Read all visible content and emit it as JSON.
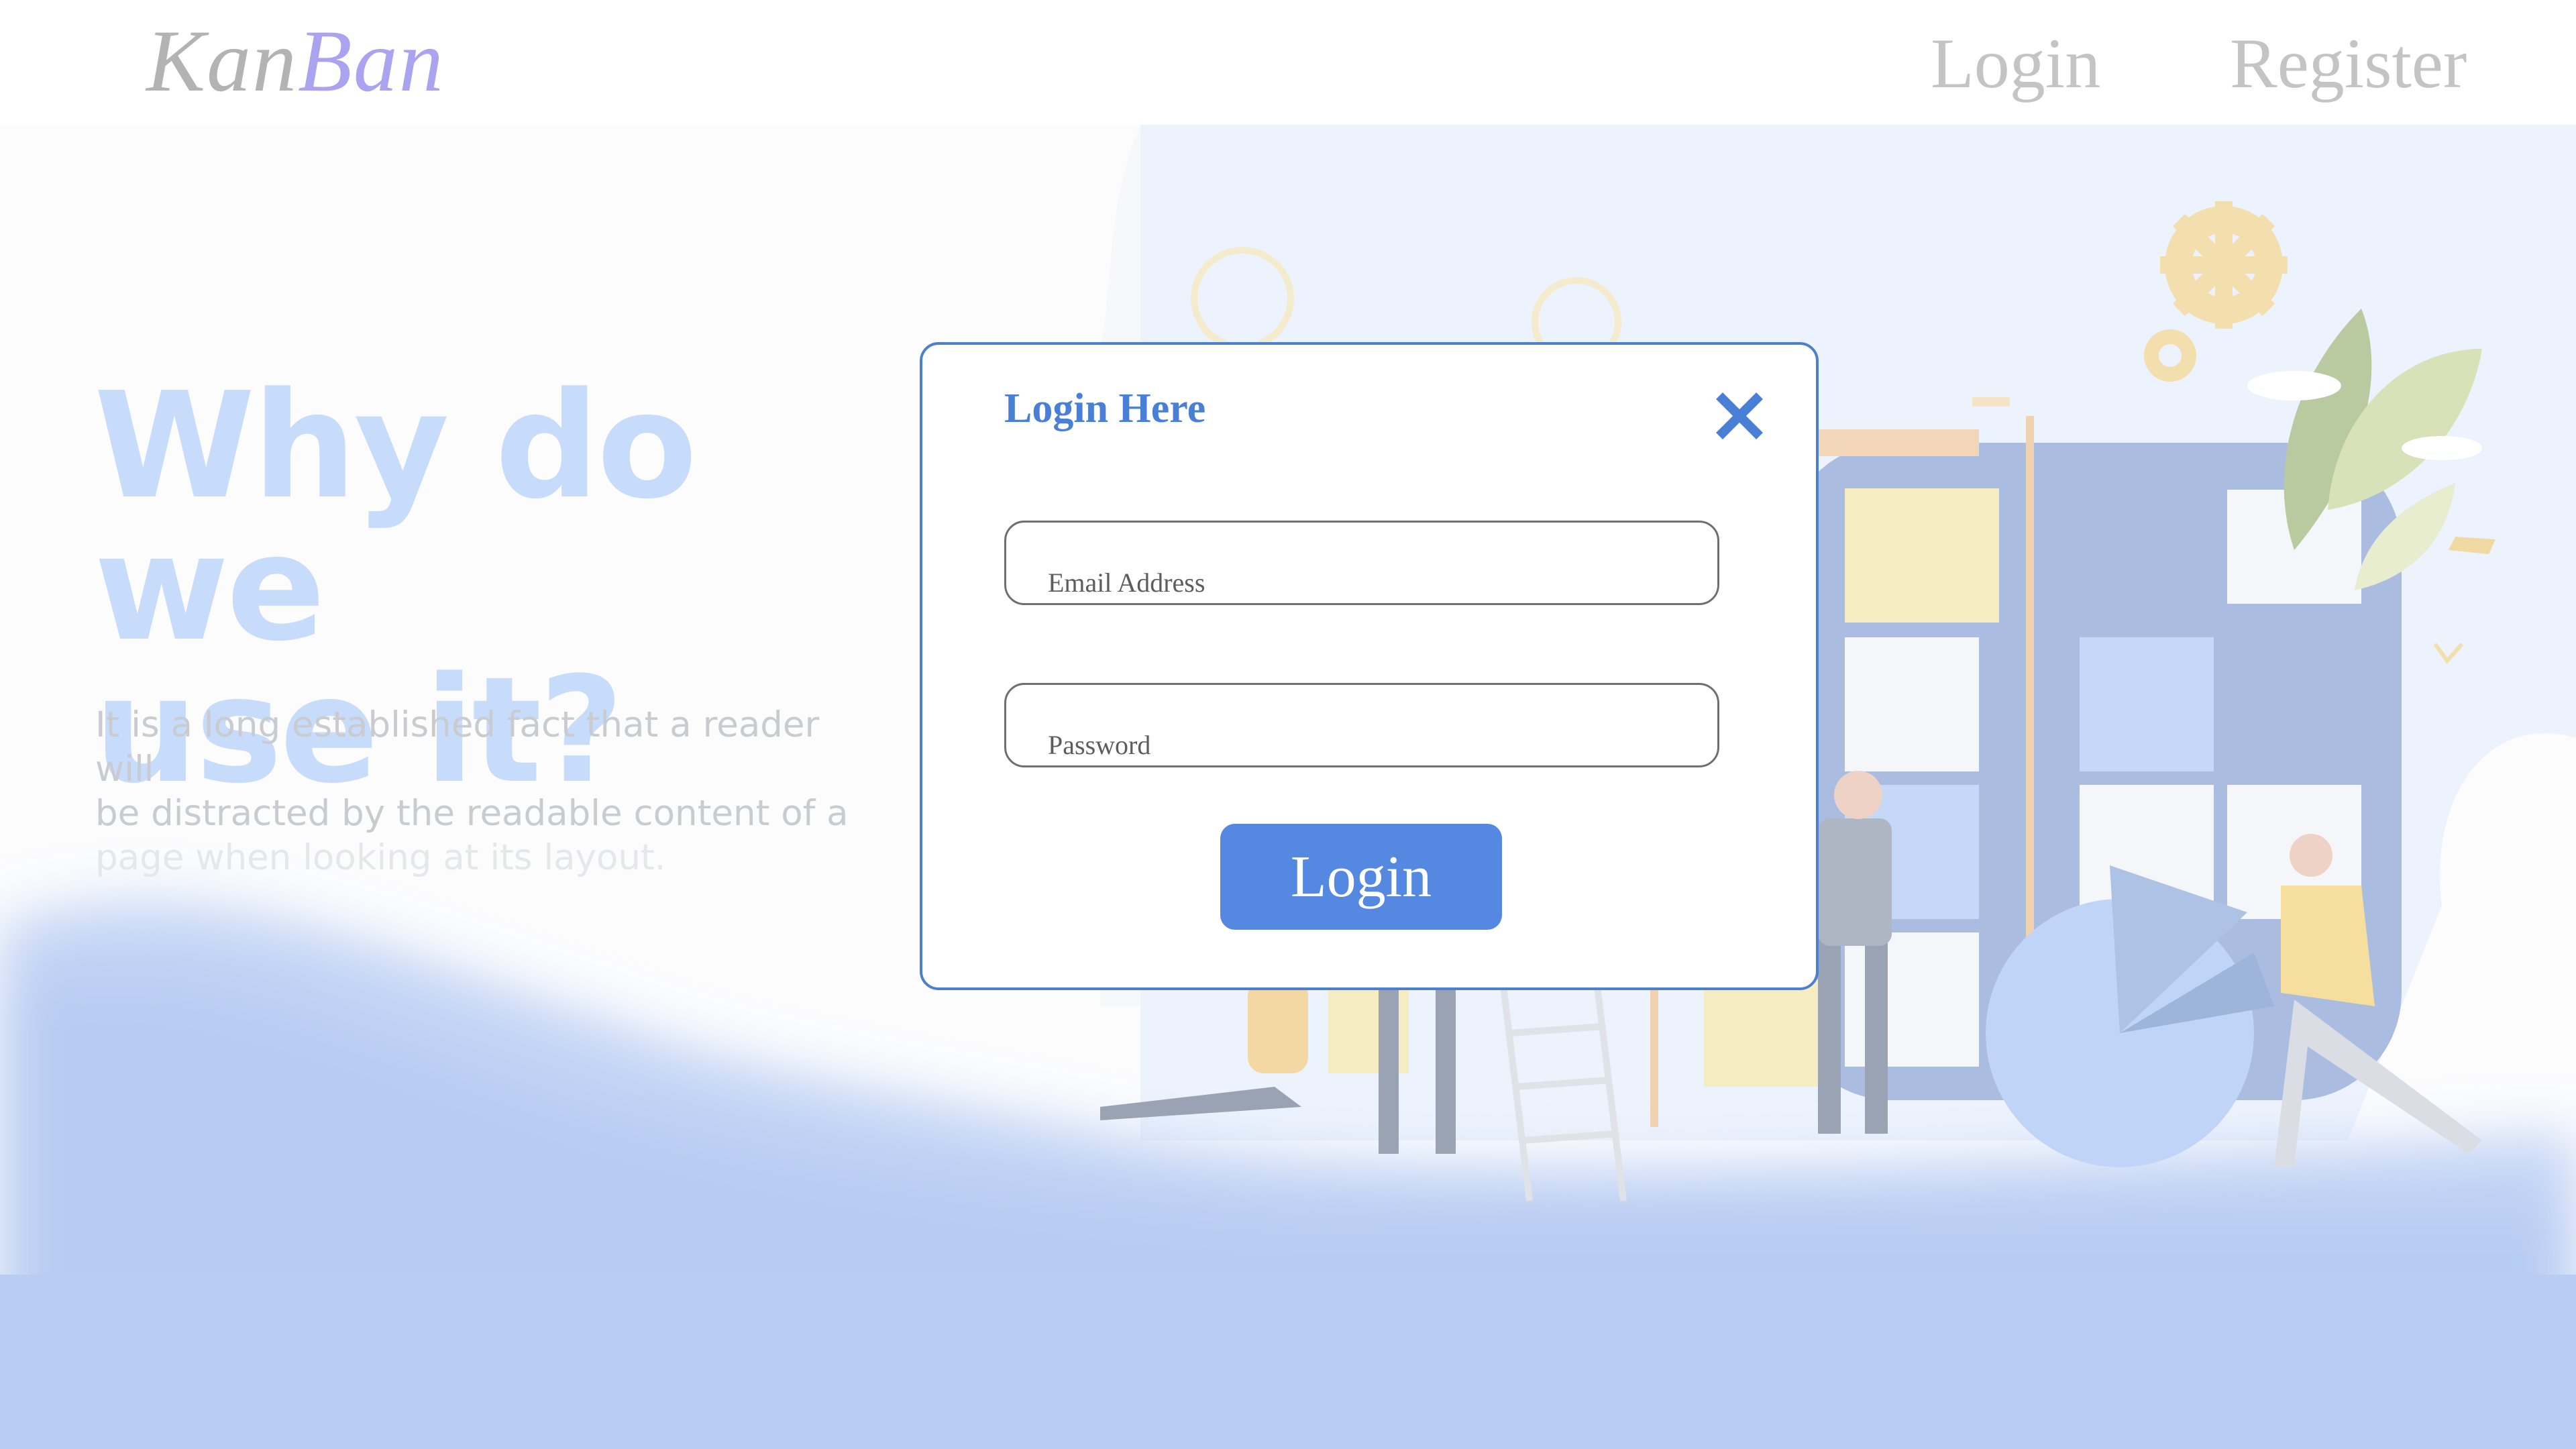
{
  "app": {
    "logo_part1": "Kan",
    "logo_part2": "Ban"
  },
  "nav": {
    "login_label": "Login",
    "register_label": "Register"
  },
  "hero": {
    "title_line1": "Why do we",
    "title_line2": "use it?",
    "text_line1": "It is a long established fact that a reader will",
    "text_line2": "be distracted by the readable content of a",
    "text_line3": "page when looking at its layout."
  },
  "modal": {
    "title": "Login Here",
    "close_icon": "close-icon",
    "email_placeholder": "Email Address",
    "email_value": "",
    "password_placeholder": "Password",
    "password_value": "",
    "submit_label": "Login"
  },
  "colors": {
    "accent": "#5588e0",
    "modal_border": "#4b7fd0",
    "logo_accent": "#a9a3f0",
    "hero_title": "#c7dcfb",
    "background_wave": "#b9cdf3"
  }
}
